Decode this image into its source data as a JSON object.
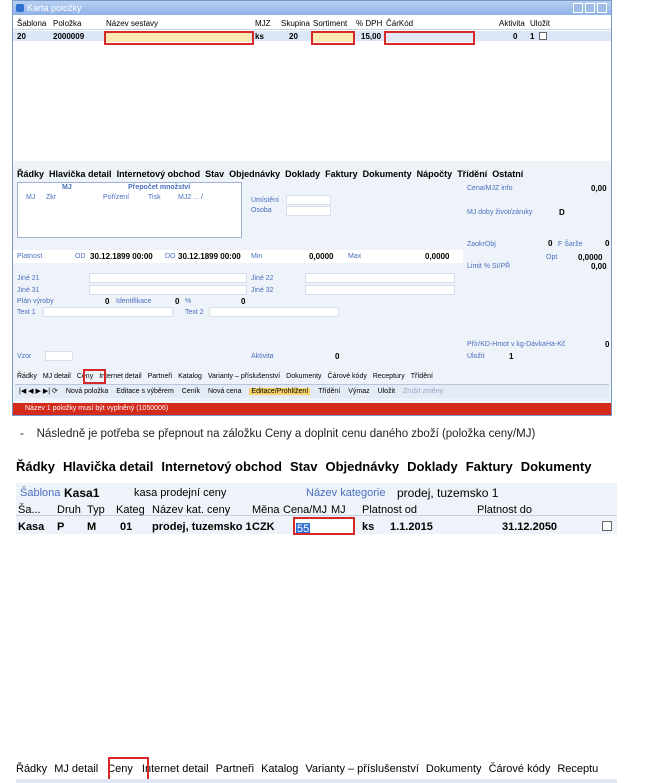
{
  "window1": {
    "title": "Karta položky",
    "grid": {
      "headers": [
        "Šablona",
        "Položka",
        "Název sestavy",
        "MJZ",
        "Skupina",
        "Sortiment",
        "% DPH",
        "ČárKód",
        "Aktivita",
        "Uložit"
      ],
      "row": {
        "sablona": "20",
        "polozka": "2000009",
        "nazev": "",
        "mjz": "ks",
        "skupina": "20",
        "sortiment": "",
        "dph": "15,00",
        "carkod": "",
        "aktivita": "0",
        "ulozit": "1"
      }
    },
    "tabs": [
      "Řádky",
      "Hlavička detail",
      "Internetový obchod",
      "Stav",
      "Objednávky",
      "Doklady",
      "Faktury",
      "Dokumenty",
      "Nápočty",
      "Třídění",
      "Ostatní"
    ],
    "mj_table": {
      "title": "MJ",
      "prepocet": "Přepočet množství",
      "cols": [
        "MJ",
        "Zkr",
        "Pořízení",
        "Tisk",
        "MJ2 ... /"
      ]
    },
    "left_labels": {
      "umisteni": "Umístění",
      "osoba": "Osoba"
    },
    "right_panel": {
      "cena_mjz_label": "Cena/MJZ info",
      "cena_mjz_value": "0,00",
      "mj_doby_label": "MJ doby život/záruky",
      "mj_doby_value": "D",
      "zaokr_label": "ZaokrObj",
      "zaokr_value": "0",
      "f_sarze": "F Šarže",
      "f_sarze_value": "0",
      "opt_label": "Opt",
      "opt_value": "0,0000",
      "limit_label": "Limit % SI/PŘ",
      "limit_value": "0,00",
      "prir_label": "Přír/KD-Hmot v kg-DávkaHa-Kč",
      "prir_value": "0",
      "ulozit_label": "Uložit",
      "ulozit_value": "1"
    },
    "platnost": {
      "label": "Platnost",
      "od_label": "OD",
      "od": "30.12.1899 00:00",
      "do_label": "DO",
      "do": "30.12.1899 00:00",
      "min_label": "Min",
      "min": "0,0000",
      "max_label": "Max",
      "max": "0,0000"
    },
    "jine": {
      "j21": "Jiné 21",
      "j31": "Jiné 31",
      "j22": "Jiné 22",
      "j32": "Jiné 32"
    },
    "plan": {
      "label": "Plán výroby",
      "value": "0",
      "ident_label": "Identifikace",
      "ident_value": "0",
      "pct": "%",
      "pct_value": "0"
    },
    "text1": "Text 1",
    "text2": "Text 2",
    "vzor": "Vzor",
    "aktivita_label": "Aktivita",
    "aktivita_value": "0",
    "subtabs": [
      "Řádky",
      "MJ detail",
      "Ceny",
      "Internet detail",
      "Partneři",
      "Katalog",
      "Varianty – příslušenství",
      "Dokumenty",
      "Čárové kódy",
      "Receptury",
      "Třídění"
    ],
    "toolbar": {
      "nova": "Nová položka",
      "editace": "Editace s výběrem",
      "cenik": "Ceník",
      "nova_cena": "Nová cena",
      "editace_proh": "Editace/Prohlížení",
      "trideni": "Třídění",
      "vymaz": "Výmaz",
      "ulozit": "Uložit",
      "zrusit": "Zrušit změny"
    },
    "status": "Název 1 položky musí být vyplněný (1050006)"
  },
  "instruction": "Následně je potřeba se přepnout na záložku Ceny a doplnit cenu daného zboží (položka ceny/MJ)",
  "window2": {
    "tabs": [
      "Řádky",
      "Hlavička detail",
      "Internetový obchod",
      "Stav",
      "Objednávky",
      "Doklady",
      "Faktury",
      "Dokumenty"
    ],
    "sablona_label": "Šablona",
    "sablona": "Kasa1",
    "sablona_desc": "kasa prodejní ceny",
    "kat_label": "Název kategorie",
    "kat": "prodej, tuzemsko 1",
    "headers": [
      "Ša...",
      "Druh",
      "Typ",
      "Kateg",
      "Název kat. ceny",
      "Měna",
      "Cena/MJ",
      "MJ",
      "Platnost od",
      "Platnost do"
    ],
    "row": {
      "sa": "Kasa",
      "druh": "P",
      "typ": "M",
      "kateg": "01",
      "nazev": "prodej, tuzemsko 1",
      "mena": "CZK",
      "cena": "55",
      "mj": "ks",
      "od": "1.1.2015",
      "do": "31.12.2050"
    },
    "bottom_tabs": [
      "Řádky",
      "MJ detail",
      "Ceny",
      "Internet detail",
      "Partneři",
      "Katalog",
      "Varianty – příslušenství",
      "Dokumenty",
      "Čárové kódy",
      "Receptu"
    ]
  },
  "colors": {
    "highlight": "#d62828",
    "accent": "#4a6fbf",
    "status_bar": "#d42a1c"
  }
}
